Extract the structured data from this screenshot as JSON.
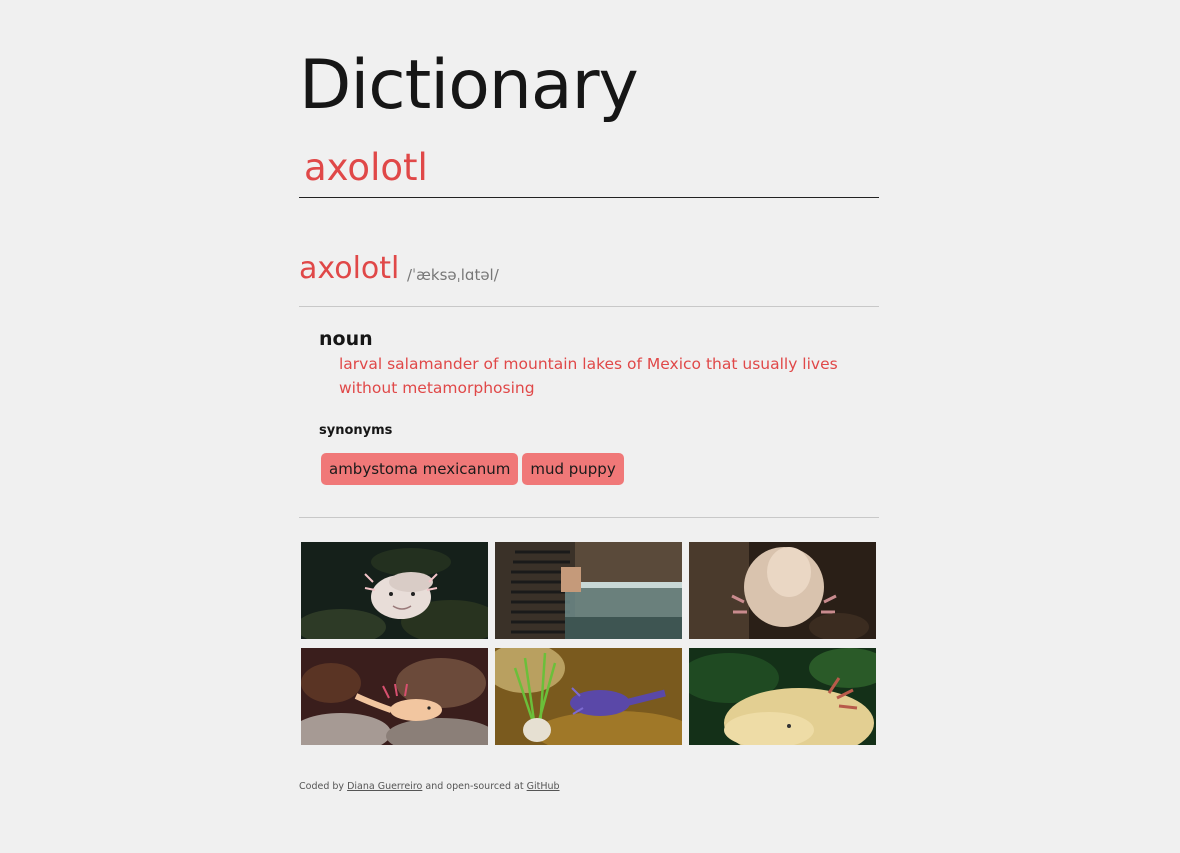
{
  "app": {
    "title": "Dictionary"
  },
  "search": {
    "value": "axolotl"
  },
  "entry": {
    "word": "axolotl",
    "phonetic": "/ˈæksəˌlɑtəl/",
    "meanings": [
      {
        "part_of_speech": "noun",
        "definition": "larval salamander of mountain lakes of Mexico that usually lives without metamorphosing",
        "synonyms_label": "synonyms",
        "synonyms": [
          "ambystoma mexicanum",
          "mud puppy"
        ]
      }
    ]
  },
  "footer": {
    "prefix": "Coded by",
    "author_link": "Diana Guerreiro",
    "middle": "and open-sourced at",
    "github_link": "GitHub"
  },
  "colors": {
    "accent": "#e04848",
    "chip": "#f07878",
    "background": "#f0f0f0"
  }
}
